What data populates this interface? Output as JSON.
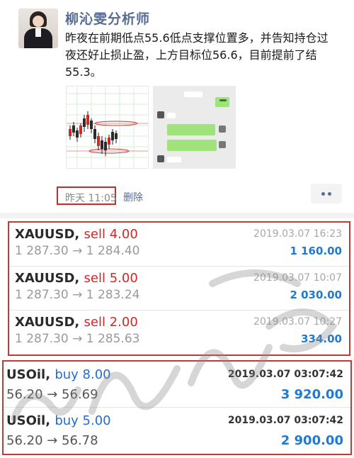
{
  "post": {
    "author": "柳沁雯分析师",
    "text": "昨夜在前期低点55.6低点支撑位置多，并告知持仓过夜还好止损止盈，上方目标位56.6，目前提前了结55.3。",
    "time": "昨天 11:05",
    "delete_label": "删除"
  },
  "trades_group_1": [
    {
      "symbol": "XAUUSD,",
      "action": "sell 4.00",
      "side": "sell",
      "prices": "1 287.30 → 1 284.40",
      "datetime": "2019.03.07 16:23",
      "profit": "1 160.00"
    },
    {
      "symbol": "XAUUSD,",
      "action": "sell 5.00",
      "side": "sell",
      "prices": "1 287.30 → 1 283.24",
      "datetime": "2019.03.07 10:07",
      "profit": "2 030.00"
    },
    {
      "symbol": "XAUUSD,",
      "action": "sell 2.00",
      "side": "sell",
      "prices": "1 287.30 → 1 285.63",
      "datetime": "2019.03.07 10:27",
      "profit": "334.00"
    }
  ],
  "trades_group_2": [
    {
      "symbol": "USOil,",
      "action": "buy 8.00",
      "side": "buy",
      "prices": "56.20 → 56.69",
      "datetime": "2019.03.07 03:07:42",
      "profit": "3 920.00"
    },
    {
      "symbol": "USOil,",
      "action": "buy 5.00",
      "side": "buy",
      "prices": "56.20 → 56.78",
      "datetime": "2019.03.07 03:07:42",
      "profit": "2 900.00"
    }
  ],
  "colors": {
    "sell": "#cc2929",
    "buy": "#1f6ed4",
    "profit": "#1f7ad4",
    "highlight_box": "#c13a3a",
    "link": "#576b95"
  },
  "icons": [
    "avatar-photo",
    "chart-thumbnail",
    "chat-screenshot-thumbnail",
    "more-dots-icon"
  ]
}
